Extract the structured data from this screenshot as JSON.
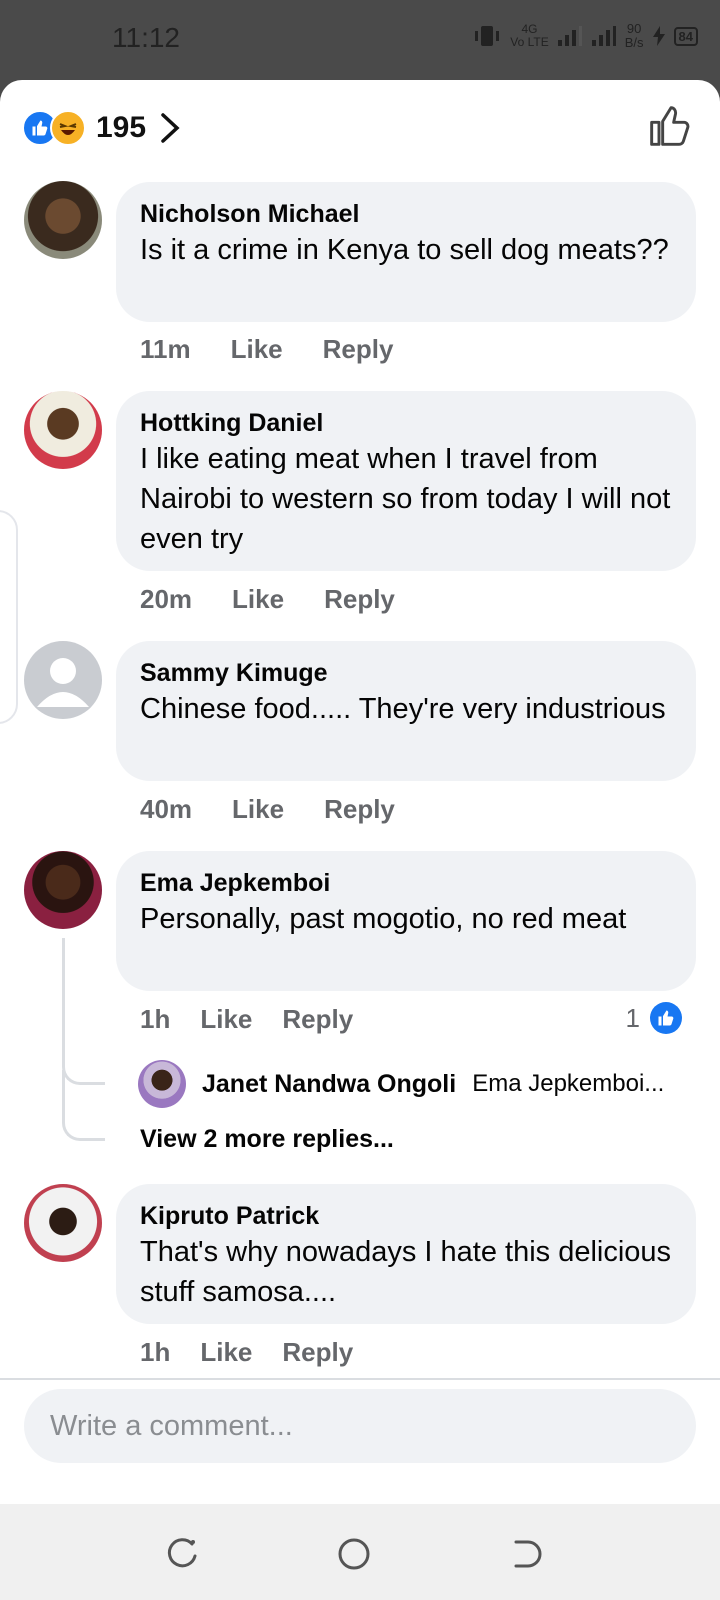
{
  "status_bar": {
    "time": "11:12",
    "network": "Vo LTE",
    "network_gen": "4G",
    "speed_value": "90",
    "speed_unit": "B/s",
    "battery": "84"
  },
  "reactions": {
    "count": "195"
  },
  "comments": [
    {
      "name": "Nicholson Michael",
      "text": "Is it a crime in Kenya to sell dog meats??",
      "time": "11m",
      "like_label": "Like",
      "reply_label": "Reply"
    },
    {
      "name": "Hottking Daniel",
      "text": "I like eating meat when I travel from Nairobi to western so from today I will not even try",
      "time": "20m",
      "like_label": "Like",
      "reply_label": "Reply"
    },
    {
      "name": "Sammy Kimuge",
      "text": "Chinese food..... They're very industrious",
      "time": "40m",
      "like_label": "Like",
      "reply_label": "Reply"
    },
    {
      "name": "Ema Jepkemboi",
      "text": "Personally, past mogotio, no red meat",
      "time": "1h",
      "like_label": "Like",
      "reply_label": "Reply",
      "like_count": "1",
      "reply_preview": {
        "name": "Janet Nandwa Ongoli",
        "text": "Ema Jepkemboi..."
      },
      "view_more": "View 2 more replies..."
    },
    {
      "name": "Kipruto Patrick",
      "text": "That's why nowadays I hate this delicious stuff samosa....",
      "time": "1h",
      "like_label": "Like",
      "reply_label": "Reply"
    }
  ],
  "composer": {
    "placeholder": "Write a comment..."
  },
  "colors": {
    "accent": "#1877f2",
    "bubble": "#f0f2f5",
    "muted": "#65676b"
  }
}
